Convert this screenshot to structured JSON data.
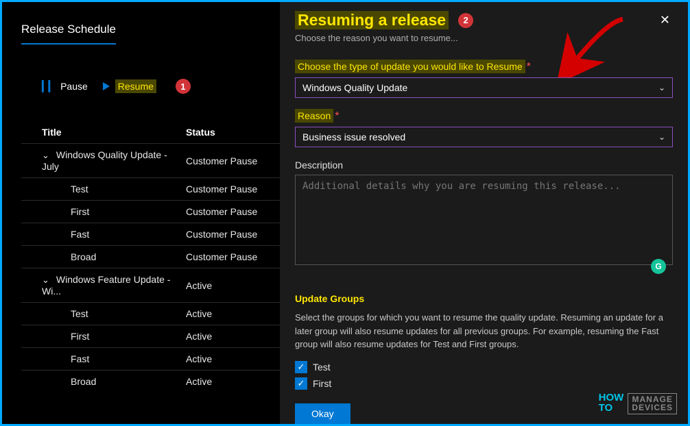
{
  "left": {
    "title": "Release Schedule",
    "actions": {
      "pause": "Pause",
      "resume": "Resume"
    },
    "callouts": {
      "one": "1",
      "two": "2"
    },
    "columns": {
      "title": "Title",
      "status": "Status"
    },
    "rows": [
      {
        "label": "Windows Quality Update - July",
        "status": "Customer Pause",
        "parent": true
      },
      {
        "label": "Test",
        "status": "Customer Pause",
        "parent": false
      },
      {
        "label": "First",
        "status": "Customer Pause",
        "parent": false
      },
      {
        "label": "Fast",
        "status": "Customer Pause",
        "parent": false
      },
      {
        "label": "Broad",
        "status": "Customer Pause",
        "parent": false
      },
      {
        "label": "Windows Feature Update - Wi...",
        "status": "Active",
        "parent": true
      },
      {
        "label": "Test",
        "status": "Active",
        "parent": false
      },
      {
        "label": "First",
        "status": "Active",
        "parent": false
      },
      {
        "label": "Fast",
        "status": "Active",
        "parent": false
      },
      {
        "label": "Broad",
        "status": "Active",
        "parent": false
      }
    ]
  },
  "panel": {
    "title": "Resuming a release",
    "subtitle": "Choose the reason you want to resume...",
    "typeLabel": "Choose the type of update you would like to Resume",
    "typeValue": "Windows Quality Update",
    "reasonLabel": "Reason",
    "reasonValue": "Business issue resolved",
    "descLabel": "Description",
    "descPlaceholder": "Additional details why you are resuming this release...",
    "groupsHeading": "Update Groups",
    "groupsHelp": "Select the groups for which you want to resume the quality update. Resuming an update for a later group will also resume updates for all previous groups. For example, resuming the Fast group will also resume updates for Test and First groups.",
    "checkboxes": [
      "Test",
      "First"
    ],
    "okay": "Okay"
  },
  "watermark": {
    "how": "HOW",
    "to": "TO",
    "manage1": "MANAGE",
    "manage2": "DEVICES"
  }
}
